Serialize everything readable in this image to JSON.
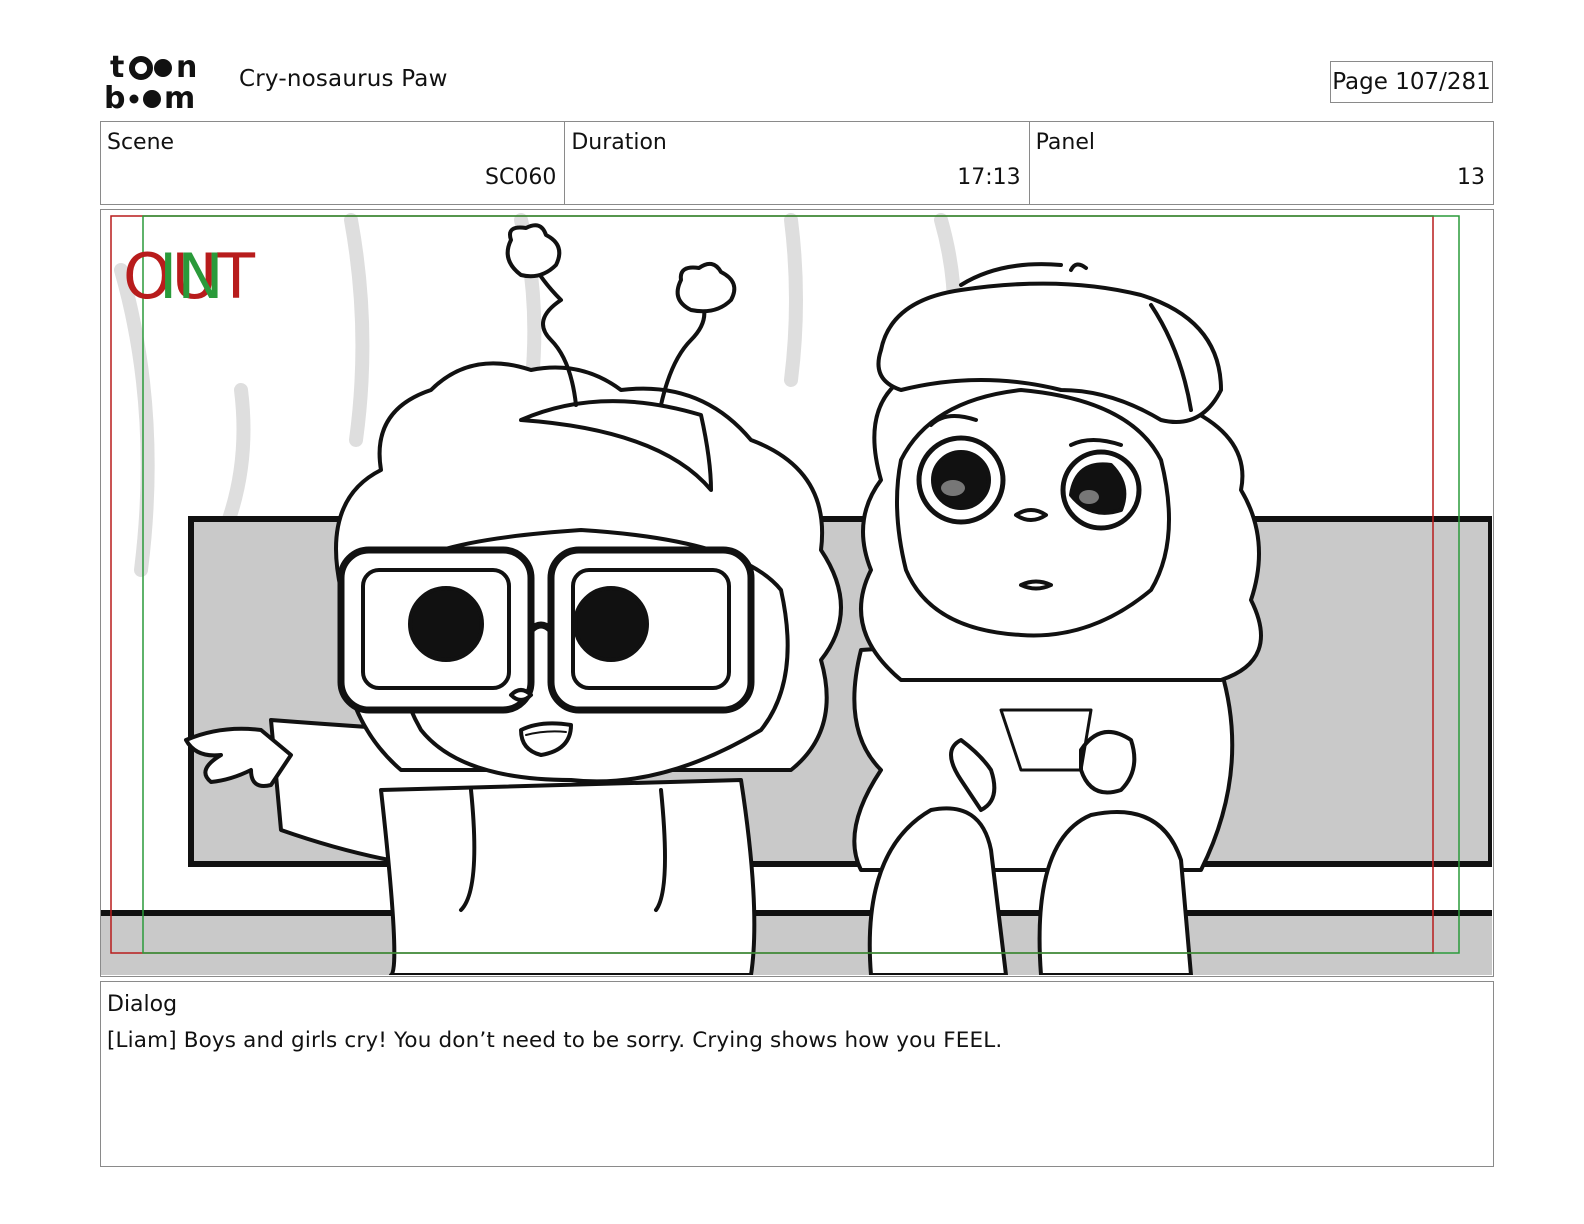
{
  "header": {
    "logo_text": "toon boom",
    "project_title": "Cry-nosaurus Paw",
    "page_indicator": "Page 107/281"
  },
  "info": {
    "scene_label": "Scene",
    "scene_value": "SC060",
    "duration_label": "Duration",
    "duration_value": "17:13",
    "panel_label": "Panel",
    "panel_value": "13"
  },
  "panel": {
    "out_marker": "OUT",
    "in_marker": "IN",
    "out_color": "#b81c1c",
    "in_color": "#2a9a3a"
  },
  "dialog": {
    "label": "Dialog",
    "text": "[Liam] Boys and girls cry! You don’t need to be sorry. Crying shows how you FEEL."
  }
}
